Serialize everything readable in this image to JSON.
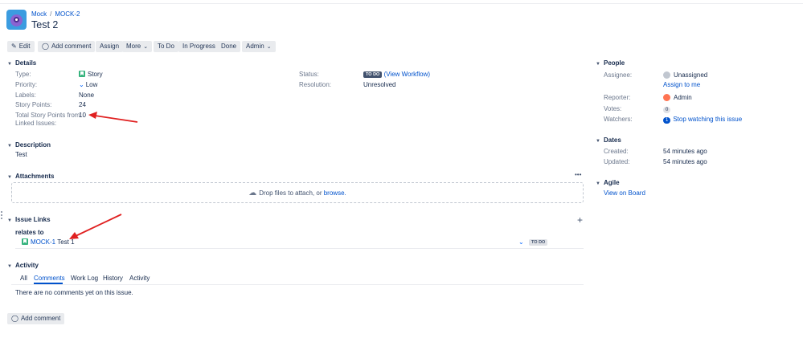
{
  "breadcrumb": {
    "project": "Mock",
    "issue_key": "MOCK-2"
  },
  "issue": {
    "title": "Test 2"
  },
  "toolbar": {
    "edit": "Edit",
    "add_comment": "Add comment",
    "assign": "Assign",
    "more": "More",
    "to_do": "To Do",
    "in_progress": "In Progress",
    "done": "Done",
    "admin": "Admin"
  },
  "details": {
    "heading": "Details",
    "type_label": "Type:",
    "type_value": "Story",
    "priority_label": "Priority:",
    "priority_value": "Low",
    "labels_label": "Labels:",
    "labels_value": "None",
    "story_points_label": "Story Points:",
    "story_points_value": "24",
    "total_points_label_1": "Total Story Points from",
    "total_points_label_2": "Linked Issues:",
    "total_points_value": "10",
    "status_label": "Status:",
    "status_lozenge": "TO DO",
    "view_workflow": "(View Workflow)",
    "resolution_label": "Resolution:",
    "resolution_value": "Unresolved"
  },
  "description": {
    "heading": "Description",
    "text": "Test"
  },
  "attachments": {
    "heading": "Attachments",
    "menu": "•••",
    "drop_text": "Drop files to attach, or",
    "browse": "browse."
  },
  "issue_links": {
    "heading": "Issue Links",
    "add": "+",
    "relation": "relates to",
    "link_key": "MOCK-1",
    "link_summary": "Test 1",
    "link_status": "TO DO"
  },
  "activity": {
    "heading": "Activity",
    "tabs": [
      "All",
      "Comments",
      "Work Log",
      "History",
      "Activity"
    ],
    "active_tab": "Comments",
    "empty": "There are no comments yet on this issue.",
    "add_comment": "Add comment"
  },
  "people": {
    "heading": "People",
    "assignee_label": "Assignee:",
    "assignee_value": "Unassigned",
    "assign_to_me": "Assign to me",
    "reporter_label": "Reporter:",
    "reporter_value": "Admin",
    "votes_label": "Votes:",
    "votes_value": "0",
    "watchers_label": "Watchers:",
    "watchers_count": "1",
    "stop_watching": "Stop watching this issue"
  },
  "dates": {
    "heading": "Dates",
    "created_label": "Created:",
    "created_value": "54 minutes ago",
    "updated_label": "Updated:",
    "updated_value": "54 minutes ago"
  },
  "agile": {
    "heading": "Agile",
    "view_on_board": "View on Board"
  },
  "colors": {
    "link": "#0052cc",
    "button_bg": "#e9ebee",
    "annotation_arrow": "#e02020",
    "story_green": "#36b37e"
  }
}
